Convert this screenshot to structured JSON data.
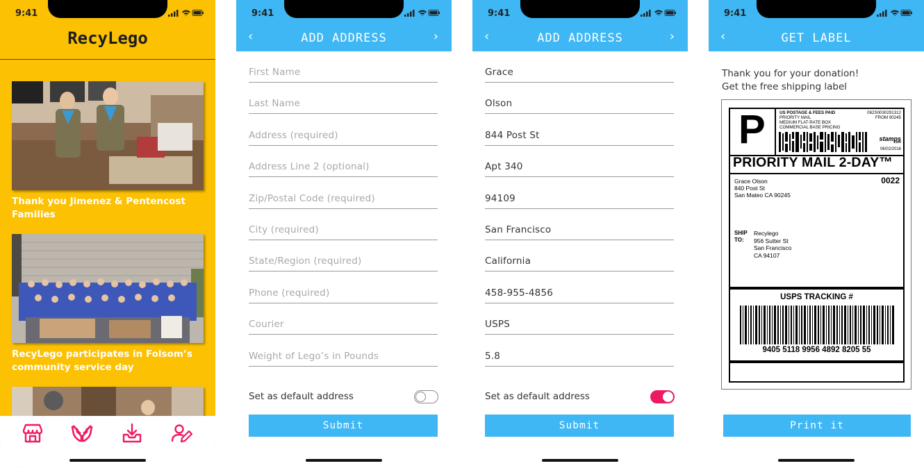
{
  "status": {
    "time": "9:41"
  },
  "feed": {
    "brand": "RecyLego",
    "posts": [
      {
        "caption": "Thank you Jimenez & Pentencost Families"
      },
      {
        "caption": "RecyLego participates in Folsom’s community service day"
      }
    ],
    "tabs": [
      "store-icon",
      "donate-hands-icon",
      "download-icon",
      "profile-edit-icon"
    ],
    "colors": {
      "background": "#fcc103",
      "accent": "#ef1962"
    }
  },
  "add_address_empty": {
    "title": "ADD ADDRESS",
    "fields": [
      "First Name",
      "Last Name",
      "Address (required)",
      "Address Line 2 (optional)",
      "Zip/Postal Code (required)",
      "City (required)",
      "State/Region (required)",
      "Phone (required)",
      "Courier",
      "Weight of Lego’s in Pounds"
    ],
    "default_label": "Set as default address",
    "default_on": false,
    "submit": "Submit"
  },
  "add_address_filled": {
    "title": "ADD ADDRESS",
    "fields": [
      "Grace",
      "Olson",
      "844 Post St",
      "Apt 340",
      "94109",
      "San Francisco",
      "California",
      "458-955-4856",
      "USPS",
      "5.8"
    ],
    "default_label": "Set as default address",
    "default_on": true,
    "submit": "Submit"
  },
  "label_screen": {
    "title": "GET LABEL",
    "thanks_line1": "Thank you for your donation!",
    "thanks_line2": "Get the free shipping label",
    "print": "Print it",
    "label": {
      "postage_line1": "US POSTAGE & FEES PAID",
      "postage_line2": "PRIORITY MAIL",
      "postage_line3": "MEDIUM FLAT-RATE BOX",
      "postage_line4": "COMMERCIAL BASE PRICING",
      "postage_id": "062S0030291312",
      "from_zip": "FROM 90245",
      "stamps_brand": "stamps",
      "stamps_domain": "com",
      "date": "06/02/2016",
      "class_title": "PRIORITY MAIL 2-DAY™",
      "sender": [
        "Grace Olson",
        "840 Post St",
        "San Mateo CA 90245"
      ],
      "code": "0022",
      "ship_to": "SHIP\nTO:",
      "recipient": [
        "Recylego",
        "956 Sutter St",
        "San Francisco",
        "CA 94107"
      ],
      "tracking_title": "USPS TRACKING #",
      "tracking_number": "9405 5118 9956 4892 8205 55"
    }
  },
  "colors": {
    "header": "#3fb7f5",
    "toggle_on": "#ef1962"
  }
}
